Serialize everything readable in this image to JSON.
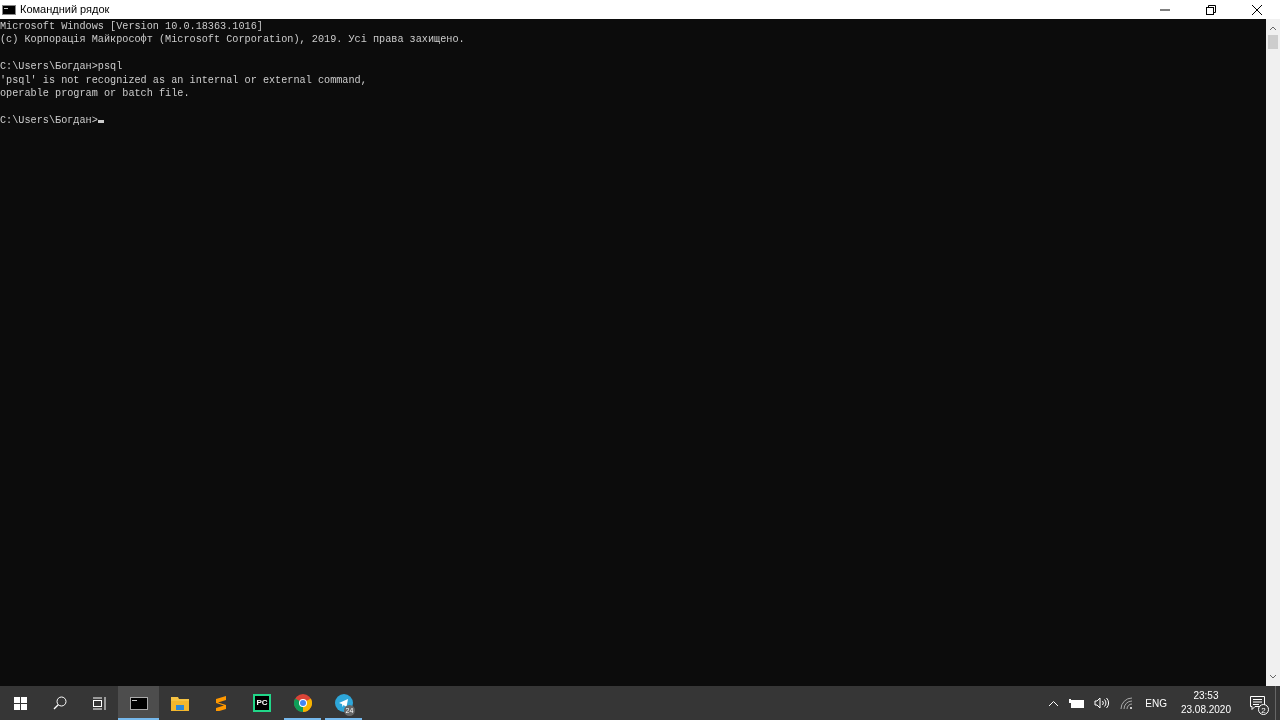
{
  "window": {
    "title": "Командний рядок"
  },
  "console": {
    "blocks": [
      [
        "Microsoft Windows [Version 10.0.18363.1016]",
        "(c) Корпорація Майкрософт (Microsoft Corporation), 2019. Усі права захищено."
      ],
      [
        "C:\\Users\\Богдан>psql",
        "'psql' is not recognized as an internal or external command,",
        "operable program or batch file."
      ],
      [
        "C:\\Users\\Богдан>"
      ]
    ],
    "cursor": true
  },
  "taskbar": {
    "apps": [
      {
        "kind": "terminal",
        "running": true,
        "selected": true
      },
      {
        "kind": "folder",
        "running": false,
        "selected": false
      },
      {
        "kind": "sublime",
        "running": false,
        "selected": false
      },
      {
        "kind": "pycharm",
        "label": "PC",
        "running": false,
        "selected": false
      },
      {
        "kind": "chrome",
        "running": true,
        "selected": false
      },
      {
        "kind": "telegram",
        "badge": "24",
        "running": true,
        "selected": false
      }
    ],
    "language": "ENG",
    "time": "23:53",
    "date": "23.08.2020",
    "notifications": "2"
  }
}
